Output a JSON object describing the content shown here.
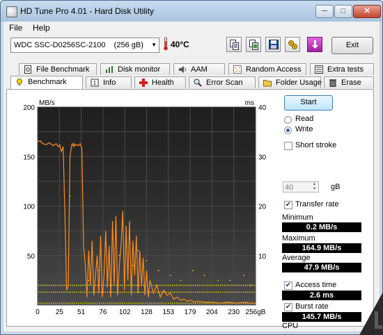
{
  "window": {
    "title": "HD Tune Pro 4.01 - Hard Disk Utility"
  },
  "titlebar_buttons": {
    "minimize": "─",
    "maximize": "□",
    "close": "✕"
  },
  "menu": {
    "file": "File",
    "help": "Help"
  },
  "toolbar": {
    "drive": "WDC SSC-D0256SC-2100",
    "drive_size": "(256 gB)",
    "temperature": "40°C",
    "icons": [
      "copy-info-icon",
      "copy-screenshot-icon",
      "save-icon",
      "options-icon",
      "down-arrow-icon"
    ],
    "exit_label": "Exit"
  },
  "tabs_top": [
    "File Benchmark",
    "Disk monitor",
    "AAM",
    "Random Access",
    "Extra tests"
  ],
  "tabs_bottom": [
    "Benchmark",
    "Info",
    "Health",
    "Error Scan",
    "Folder Usage",
    "Erase"
  ],
  "active_tab": "Benchmark",
  "controls": {
    "start_label": "Start",
    "read_label": "Read",
    "write_label": "Write",
    "selected_mode": "Write",
    "short_stroke_label": "Short stroke",
    "short_stroke_checked": false,
    "short_stroke_value": "40",
    "short_stroke_unit": "gB",
    "transfer_rate_label": "Transfer rate",
    "transfer_rate_checked": true,
    "access_time_label": "Access time",
    "access_time_checked": true,
    "burst_rate_label": "Burst rate",
    "burst_rate_checked": true
  },
  "stats": {
    "minimum_label": "Minimum",
    "minimum": "0.2 MB/s",
    "maximum_label": "Maximum",
    "maximum": "164.9 MB/s",
    "average_label": "Average",
    "average": "47.9 MB/s",
    "access_time": "2.6 ms",
    "burst_rate": "145.7 MB/s",
    "cpu_label": "CPU"
  },
  "colors": {
    "chart_bg": "#2d2d2d",
    "grid": "#4a4a4a",
    "transfer": "#ff8c1a",
    "access": "#e8e000",
    "stat_bg": "#000000",
    "stat_fg": "#ffffff"
  },
  "chart_data": {
    "type": "line",
    "y_left_unit": "MB/s",
    "y_right_unit": "ms",
    "ylim_left": [
      0,
      200
    ],
    "ylim_right": [
      0,
      40
    ],
    "y_left_ticks": [
      50,
      100,
      150,
      200
    ],
    "y_right_ticks": [
      10,
      20,
      30,
      40
    ],
    "x_ticks": [
      "0",
      "25",
      "51",
      "76",
      "102",
      "128",
      "153",
      "179",
      "204",
      "230",
      "256gB"
    ],
    "xlim": [
      0,
      256
    ],
    "grid": true,
    "transfer_rate_series": {
      "name": "Transfer rate",
      "x": [
        0,
        3,
        6,
        10,
        14,
        18,
        22,
        24,
        26,
        28,
        30,
        32,
        34,
        36,
        38,
        40,
        41,
        42,
        43,
        44,
        46,
        48,
        50,
        52,
        53,
        54,
        56,
        58,
        60,
        62,
        64,
        66,
        68,
        70,
        72,
        74,
        76,
        78,
        80,
        82,
        84,
        86,
        88,
        90,
        92,
        94,
        96,
        98,
        100,
        102,
        104,
        106,
        108,
        110,
        112,
        114,
        116,
        118,
        120,
        122,
        124,
        126,
        128,
        130,
        132,
        136,
        140,
        144,
        148,
        152,
        156,
        160,
        164,
        168,
        172,
        176,
        180,
        184,
        188,
        196,
        204,
        214,
        224,
        234,
        244,
        250,
        256
      ],
      "y": [
        165,
        166,
        163,
        162,
        164,
        161,
        163,
        160,
        162,
        155,
        160,
        95,
        15,
        20,
        150,
        162,
        163,
        160,
        163,
        161,
        162,
        161,
        163,
        158,
        110,
        60,
        40,
        8,
        55,
        20,
        65,
        10,
        30,
        50,
        12,
        70,
        8,
        30,
        75,
        18,
        60,
        8,
        85,
        20,
        90,
        10,
        40,
        60,
        95,
        15,
        80,
        25,
        85,
        10,
        65,
        30,
        70,
        12,
        55,
        20,
        48,
        10,
        35,
        8,
        25,
        12,
        20,
        8,
        15,
        10,
        12,
        6,
        8,
        5,
        6,
        4,
        5,
        3,
        4,
        3,
        3,
        2,
        3,
        2,
        3,
        2,
        2
      ]
    },
    "access_time_series": {
      "name": "Access time",
      "band_ms": [
        4.0,
        2.6,
        0.4
      ],
      "scattered_ms": [
        [
          38,
          22
        ],
        [
          60,
          5
        ],
        [
          72,
          7
        ],
        [
          84,
          9
        ],
        [
          96,
          10
        ],
        [
          104,
          12
        ],
        [
          112,
          8
        ],
        [
          118,
          11
        ],
        [
          128,
          9
        ],
        [
          142,
          7
        ],
        [
          156,
          6
        ],
        [
          168,
          5
        ],
        [
          182,
          7
        ],
        [
          196,
          6
        ],
        [
          212,
          5
        ],
        [
          226,
          5
        ],
        [
          242,
          6
        ],
        [
          250,
          4
        ]
      ]
    }
  }
}
